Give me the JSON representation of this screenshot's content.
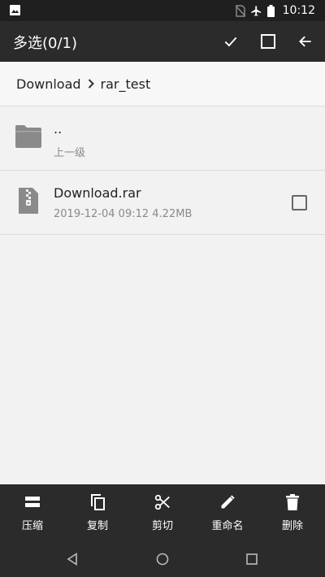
{
  "status_bar": {
    "time": "10:12",
    "icons": [
      "image-icon",
      "no-sim-icon",
      "airplane-icon",
      "battery-icon"
    ]
  },
  "action_bar": {
    "title": "多选(0/1)",
    "actions": [
      "check-icon",
      "select-all-icon",
      "back-arrow-icon"
    ]
  },
  "breadcrumb": {
    "items": [
      "Download",
      "rar_test"
    ]
  },
  "files": [
    {
      "name": "..",
      "detail": "上一级",
      "icon": "folder-icon"
    },
    {
      "name": "Download.rar",
      "detail": "2019-12-04 09:12  4.22MB",
      "icon": "zip-file-icon",
      "checked": false
    }
  ],
  "toolbar": {
    "items": [
      {
        "label": "压缩",
        "icon": "compress-icon"
      },
      {
        "label": "复制",
        "icon": "copy-icon"
      },
      {
        "label": "剪切",
        "icon": "cut-icon"
      },
      {
        "label": "重命名",
        "icon": "rename-icon"
      },
      {
        "label": "删除",
        "icon": "delete-icon"
      }
    ]
  },
  "nav_bar": {
    "buttons": [
      "back-nav-icon",
      "home-nav-icon",
      "recents-nav-icon"
    ]
  },
  "colors": {
    "bar": "#2b2b2b",
    "status": "#1f1f1f",
    "background": "#f2f2f2"
  }
}
